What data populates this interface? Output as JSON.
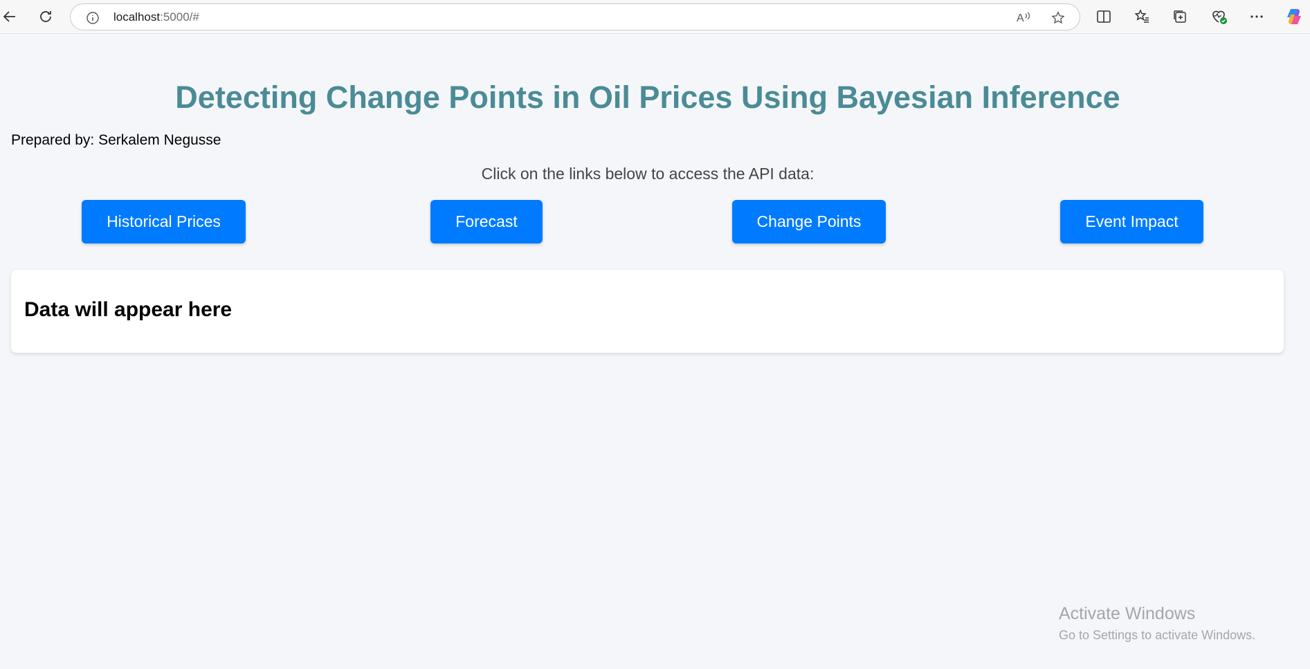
{
  "browser": {
    "url_host": "localhost",
    "url_path": ":5000/#",
    "icons": [
      "back-icon",
      "refresh-icon",
      "site-info-icon",
      "read-aloud-icon",
      "favorite-star-icon",
      "split-screen-icon",
      "favorites-icon",
      "collections-icon",
      "browser-essentials-icon",
      "more-icon",
      "copilot-icon"
    ]
  },
  "page": {
    "title": "Detecting Change Points in Oil Prices Using Bayesian Inference",
    "author": "Prepared by: Serkalem Negusse",
    "instructions": "Click on the links below to access the API data:",
    "buttons": [
      "Historical Prices",
      "Forecast",
      "Change Points",
      "Event Impact"
    ],
    "output_placeholder": "Data will appear here"
  },
  "watermark": {
    "line1": "Activate Windows",
    "line2": "Go to Settings to activate Windows."
  },
  "colors": {
    "title": "#4a8b96",
    "button": "#007bff",
    "background": "#f4f6f9"
  }
}
